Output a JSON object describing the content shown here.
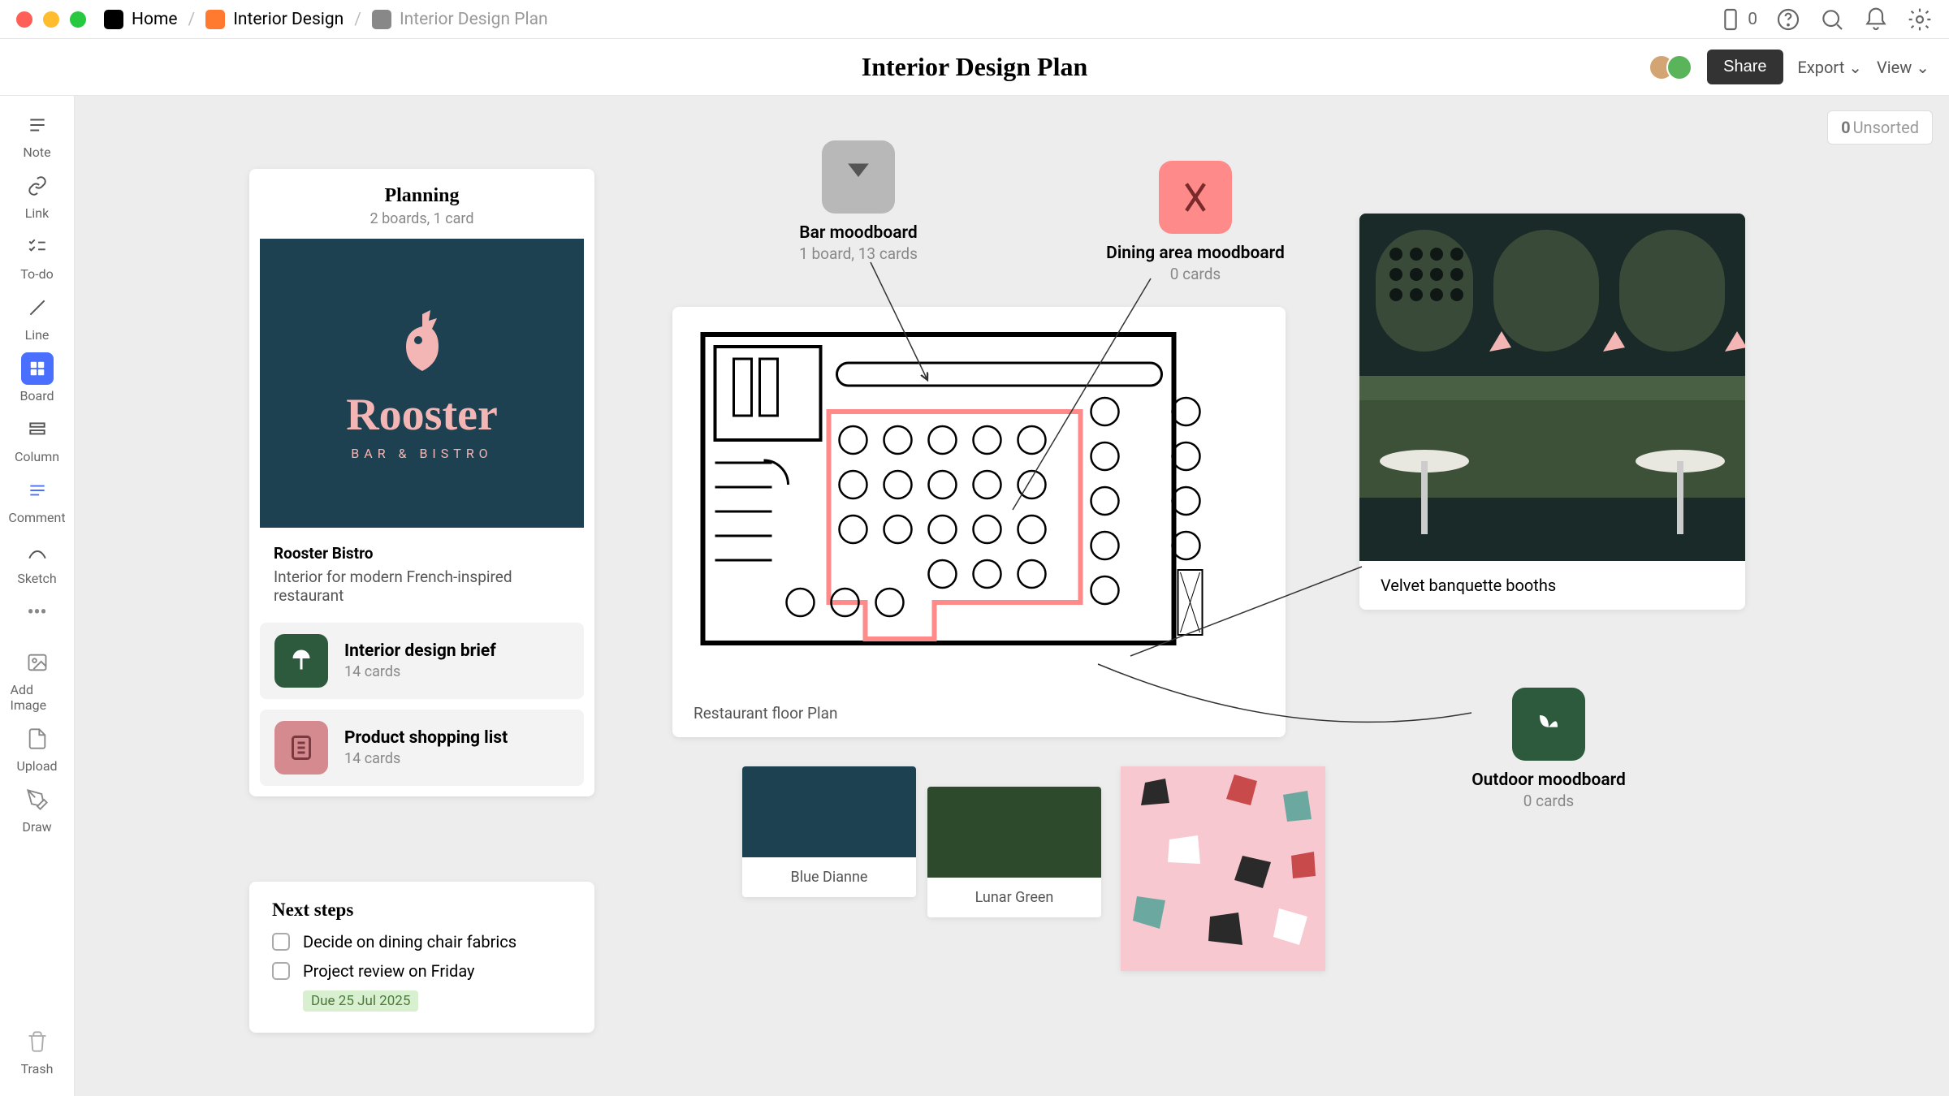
{
  "breadcrumb": {
    "home": "Home",
    "mid": "Interior Design",
    "current": "Interior Design Plan"
  },
  "titlebar_count": "0",
  "page_title": "Interior Design Plan",
  "header": {
    "share": "Share",
    "export": "Export",
    "view": "View"
  },
  "unsorted": {
    "count": "0",
    "label": "Unsorted"
  },
  "sidebar": [
    {
      "label": "Note"
    },
    {
      "label": "Link"
    },
    {
      "label": "To-do"
    },
    {
      "label": "Line"
    },
    {
      "label": "Board"
    },
    {
      "label": "Column"
    },
    {
      "label": "Comment"
    },
    {
      "label": "Sketch"
    },
    {
      "label": ""
    },
    {
      "label": "Add Image"
    },
    {
      "label": "Upload"
    },
    {
      "label": "Draw"
    }
  ],
  "sidebar_trash": "Trash",
  "planning": {
    "title": "Planning",
    "sub": "2 boards, 1 card",
    "brand": {
      "name": "Rooster",
      "tag": "BAR & BISTRO"
    },
    "desc_title": "Rooster Bistro",
    "desc_body": "Interior for modern French-inspired restaurant",
    "rows": [
      {
        "title": "Interior design brief",
        "sub": "14 cards"
      },
      {
        "title": "Product shopping list",
        "sub": "14 cards"
      }
    ]
  },
  "next": {
    "title": "Next steps",
    "items": [
      "Decide on dining chair fabrics",
      "Project review on Friday"
    ],
    "due": "Due 25 Jul 2025"
  },
  "moodboards": {
    "bar": {
      "title": "Bar moodboard",
      "sub": "1 board, 13 cards"
    },
    "dining": {
      "title": "Dining area moodboard",
      "sub": "0 cards"
    },
    "outdoor": {
      "title": "Outdoor moodboard",
      "sub": "0 cards"
    }
  },
  "floor_label": "Restaurant floor Plan",
  "photo_label": "Velvet banquette booths",
  "swatches": [
    {
      "name": "Blue Dianne",
      "hex": "#1e4152"
    },
    {
      "name": "Lunar Green",
      "hex": "#2d4a2d"
    }
  ]
}
